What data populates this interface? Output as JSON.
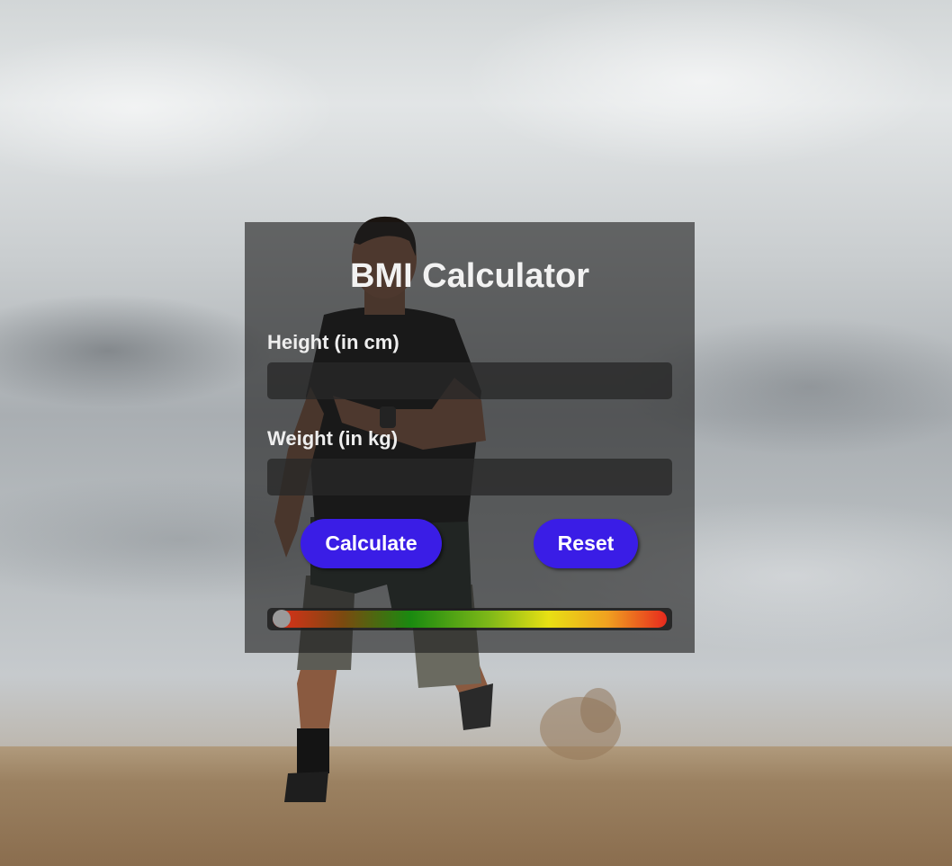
{
  "app": {
    "title": "BMI Calculator"
  },
  "form": {
    "height_label": "Height (in cm)",
    "height_value": "",
    "weight_label": "Weight (in kg)",
    "weight_value": ""
  },
  "buttons": {
    "calculate_label": "Calculate",
    "reset_label": "Reset"
  },
  "bmi_scale": {
    "indicator_position_fraction": 0.0,
    "gradient_colors": [
      "#e52d1a",
      "#1a8a10",
      "#e8e014",
      "#e62a1e"
    ]
  },
  "colors": {
    "accent": "#3a1de6",
    "card_background": "rgba(30,30,30,0.62)",
    "text": "#eeeeee"
  }
}
